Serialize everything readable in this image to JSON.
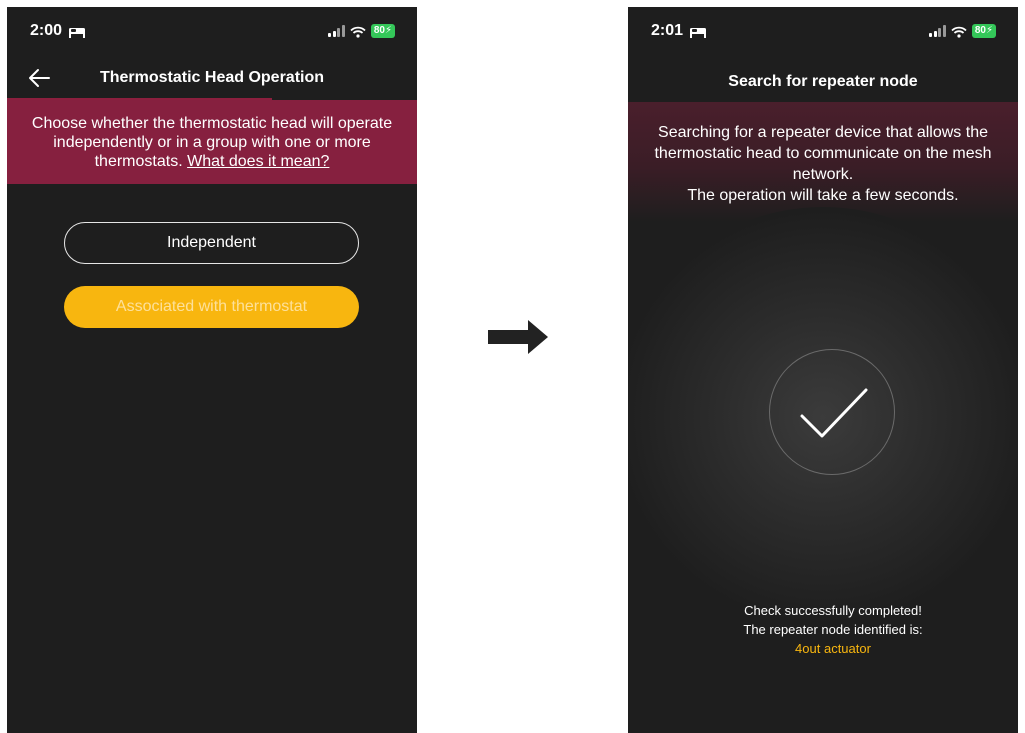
{
  "left_screen": {
    "status": {
      "time": "2:00",
      "battery": "80"
    },
    "header": {
      "title": "Thermostatic Head Operation"
    },
    "banner": {
      "text": "Choose whether the thermostatic head will operate independently or in a group with one or more thermostats.",
      "link": "What does it mean?"
    },
    "options": {
      "independent": "Independent",
      "associated": "Associated with thermostat"
    }
  },
  "transition_icon": "right-arrow-icon",
  "right_screen": {
    "status": {
      "time": "2:01",
      "battery": "80"
    },
    "header": {
      "title": "Search for repeater node"
    },
    "banner": {
      "line1": "Searching for a repeater device that allows the thermostatic head to communicate on the mesh network.",
      "line2": "The operation will take a few seconds."
    },
    "result": {
      "line1": "Check successfully completed!",
      "line2": "The repeater node identified is:",
      "node_name": "4out actuator"
    }
  },
  "colors": {
    "background": "#1e1e1e",
    "banner": "#86203f",
    "accent_yellow": "#f8b60f",
    "battery_green": "#34c759"
  }
}
